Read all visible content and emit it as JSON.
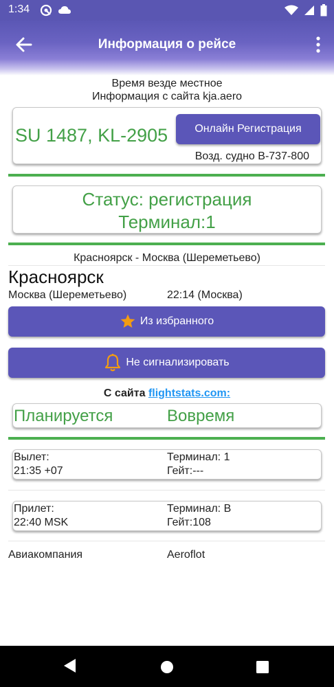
{
  "status_bar": {
    "time": "1:34",
    "left_icons": [
      "vpn-key-icon",
      "cloud-icon"
    ],
    "right_icons": [
      "wifi-icon",
      "signal-icon",
      "battery-icon"
    ]
  },
  "app_bar": {
    "title": "Информация о рейсе",
    "back_icon": "arrow-back-icon",
    "menu_icon": "more-vert-icon"
  },
  "header_notes": {
    "local_time": "Время везде местное",
    "source": "Информация с сайта kja.aero"
  },
  "flight": {
    "number": "SU 1487, KL-2905",
    "checkin_button": "Онлайн Регистрация",
    "aircraft": "Возд. судно B-737-800"
  },
  "status": {
    "status_line": "Статус: регистрация",
    "terminal_line": "Терминал:1"
  },
  "route": {
    "title": "Красноярск - Москва (Шереметьево)",
    "origin": "Красноярск",
    "destination": "Москва (Шереметьево)",
    "destination_time": "22:14 (Москва)"
  },
  "actions": {
    "favorite_label": "Из избранного",
    "notify_label": "Не сигнализировать"
  },
  "flightstats": {
    "prefix": "С сайта",
    "link": "flightstats.com:",
    "planned": "Планируется",
    "ontime": "Вовремя"
  },
  "departure": {
    "label": "Вылет:",
    "time": "21:35 +07",
    "terminal": "Терминал: 1",
    "gate": "Гейт:---"
  },
  "arrival": {
    "label": "Прилет:",
    "time": "22:40 MSK",
    "terminal": "Терминал: B",
    "gate": "Гейт:108"
  },
  "airline": {
    "label": "Авиакомпания",
    "value": "Aeroflot"
  },
  "colors": {
    "primary": "#5b56b8",
    "accent_green": "#43a047",
    "link_blue": "#2196f3",
    "star": "#f39c12"
  }
}
